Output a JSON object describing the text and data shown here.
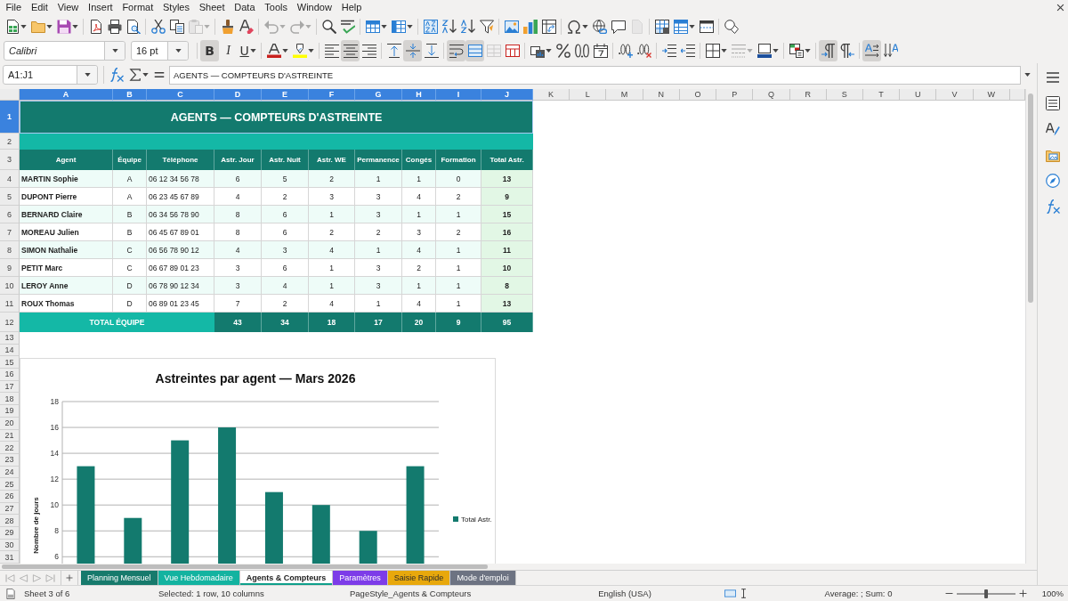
{
  "menu_bar": [
    "File",
    "Edit",
    "View",
    "Insert",
    "Format",
    "Styles",
    "Sheet",
    "Data",
    "Tools",
    "Window",
    "Help"
  ],
  "standard_toolbar": [
    [
      {
        "disabled": false
      },
      {
        "disabled": false
      },
      {
        "disabled": false
      }
    ],
    [
      {
        "disabled": false
      },
      {
        "disabled": false
      },
      {
        "disabled": false
      }
    ],
    [
      {
        "disabled": false
      },
      {
        "disabled": false
      },
      {
        "disabled": true
      }
    ],
    [
      {
        "disabled": false
      },
      {
        "disabled": false
      }
    ],
    [
      {
        "disabled": true
      },
      {
        "disabled": true
      }
    ],
    [
      {
        "disabled": false
      },
      {
        "disabled": false
      }
    ],
    [
      {
        "disabled": false
      },
      {
        "disabled": false
      }
    ],
    [
      {
        "disabled": false
      },
      {
        "disabled": false
      },
      {
        "disabled": false
      },
      {
        "disabled": false
      }
    ],
    [
      {
        "disabled": false
      },
      {
        "disabled": false
      },
      {
        "disabled": false
      }
    ],
    [
      {
        "disabled": false
      },
      {
        "disabled": false
      },
      {
        "disabled": false
      },
      {
        "disabled": true
      }
    ],
    [
      {
        "disabled": false
      },
      {
        "disabled": false
      },
      {
        "disabled": false
      }
    ],
    [
      {
        "disabled": false
      }
    ]
  ],
  "formatting_toolbar": {
    "font_name": "Calibri",
    "font_size": "16 pt",
    "text_style_buttons": [
      {
        "label": "B",
        "pressed": true
      },
      {
        "label": "I",
        "pressed": false
      },
      {
        "label": "U",
        "pressed": false
      }
    ],
    "groups": [
      [
        {
          "pressed": false,
          "disabled": false
        },
        {
          "pressed": false,
          "disabled": false
        }
      ],
      [
        {
          "pressed": false,
          "disabled": false
        },
        {
          "pressed": true,
          "disabled": false
        },
        {
          "pressed": false,
          "disabled": false
        }
      ],
      [
        {
          "pressed": false,
          "disabled": false
        },
        {
          "pressed": true,
          "disabled": false
        },
        {
          "pressed": false,
          "disabled": false
        }
      ],
      [
        {
          "pressed": true,
          "disabled": false
        },
        {
          "pressed": true,
          "disabled": false
        },
        {
          "pressed": false,
          "disabled": true
        },
        {
          "pressed": false,
          "disabled": false
        }
      ],
      [
        {
          "pressed": false,
          "disabled": false
        },
        {
          "pressed": false,
          "disabled": false
        },
        {
          "pressed": false,
          "disabled": false
        },
        {
          "pressed": false,
          "disabled": false
        }
      ],
      [
        {
          "pressed": false,
          "disabled": false
        },
        {
          "pressed": false,
          "disabled": false
        }
      ],
      [
        {
          "pressed": false,
          "disabled": false
        },
        {
          "pressed": false,
          "disabled": false
        }
      ],
      [
        {
          "pressed": false,
          "disabled": false
        },
        {
          "pressed": false,
          "disabled": true
        },
        {
          "pressed": false,
          "disabled": false
        }
      ],
      [
        {
          "pressed": false,
          "disabled": false
        }
      ],
      [
        {
          "pressed": true,
          "disabled": false
        },
        {
          "pressed": false,
          "disabled": false
        }
      ],
      [
        {
          "pressed": true,
          "disabled": false
        },
        {
          "pressed": false,
          "disabled": false
        }
      ]
    ]
  },
  "formula_bar": {
    "name_box": "A1:J1",
    "content": "AGENTS — COMPTEURS D'ASTREINTE"
  },
  "column_headers": [
    {
      "label": "A",
      "selected": true
    },
    {
      "label": "B",
      "selected": true
    },
    {
      "label": "C",
      "selected": true
    },
    {
      "label": "D",
      "selected": true
    },
    {
      "label": "E",
      "selected": true
    },
    {
      "label": "F",
      "selected": true
    },
    {
      "label": "G",
      "selected": true
    },
    {
      "label": "H",
      "selected": true
    },
    {
      "label": "I",
      "selected": true
    },
    {
      "label": "J",
      "selected": true
    },
    {
      "label": "K",
      "selected": false
    },
    {
      "label": "L",
      "selected": false
    },
    {
      "label": "M",
      "selected": false
    },
    {
      "label": "N",
      "selected": false
    },
    {
      "label": "O",
      "selected": false
    },
    {
      "label": "P",
      "selected": false
    },
    {
      "label": "Q",
      "selected": false
    },
    {
      "label": "R",
      "selected": false
    },
    {
      "label": "S",
      "selected": false
    },
    {
      "label": "T",
      "selected": false
    },
    {
      "label": "U",
      "selected": false
    },
    {
      "label": "V",
      "selected": false
    },
    {
      "label": "W",
      "selected": false
    }
  ],
  "row_headers": [
    {
      "label": "1",
      "selected": true
    },
    {
      "label": "2",
      "selected": false
    },
    {
      "label": "3",
      "selected": false
    },
    {
      "label": "4",
      "selected": false
    },
    {
      "label": "5",
      "selected": false
    },
    {
      "label": "6",
      "selected": false
    },
    {
      "label": "7",
      "selected": false
    },
    {
      "label": "8",
      "selected": false
    },
    {
      "label": "9",
      "selected": false
    },
    {
      "label": "10",
      "selected": false
    },
    {
      "label": "11",
      "selected": false
    },
    {
      "label": "12",
      "selected": false
    },
    {
      "label": "13",
      "selected": false
    },
    {
      "label": "14",
      "selected": false
    },
    {
      "label": "15",
      "selected": false
    },
    {
      "label": "16",
      "selected": false
    },
    {
      "label": "17",
      "selected": false
    },
    {
      "label": "18",
      "selected": false
    },
    {
      "label": "19",
      "selected": false
    },
    {
      "label": "20",
      "selected": false
    },
    {
      "label": "21",
      "selected": false
    },
    {
      "label": "22",
      "selected": false
    },
    {
      "label": "23",
      "selected": false
    },
    {
      "label": "24",
      "selected": false
    },
    {
      "label": "25",
      "selected": false
    },
    {
      "label": "26",
      "selected": false
    },
    {
      "label": "27",
      "selected": false
    },
    {
      "label": "28",
      "selected": false
    },
    {
      "label": "29",
      "selected": false
    },
    {
      "label": "30",
      "selected": false
    },
    {
      "label": "31",
      "selected": false
    }
  ],
  "table": {
    "title": "AGENTS — COMPTEURS D'ASTREINTE",
    "columns": [
      "Agent",
      "Équipe",
      "Téléphone",
      "Astr. Jour",
      "Astr. Nuit",
      "Astr. WE",
      "Permanence",
      "Congés",
      "Formation",
      "Total Astr."
    ],
    "rows": [
      [
        "MARTIN Sophie",
        "A",
        "06 12 34 56 78",
        "6",
        "5",
        "2",
        "1",
        "1",
        "0",
        "13"
      ],
      [
        "DUPONT Pierre",
        "A",
        "06 23 45 67 89",
        "4",
        "2",
        "3",
        "3",
        "4",
        "2",
        "9"
      ],
      [
        "BERNARD Claire",
        "B",
        "06 34 56 78 90",
        "8",
        "6",
        "1",
        "3",
        "1",
        "1",
        "15"
      ],
      [
        "MOREAU Julien",
        "B",
        "06 45 67 89 01",
        "8",
        "6",
        "2",
        "2",
        "3",
        "2",
        "16"
      ],
      [
        "SIMON Nathalie",
        "C",
        "06 56 78 90 12",
        "4",
        "3",
        "4",
        "1",
        "4",
        "1",
        "11"
      ],
      [
        "PETIT Marc",
        "C",
        "06 67 89 01 23",
        "3",
        "6",
        "1",
        "3",
        "2",
        "1",
        "10"
      ],
      [
        "LEROY Anne",
        "D",
        "06 78 90 12 34",
        "3",
        "4",
        "1",
        "3",
        "1",
        "1",
        "8"
      ],
      [
        "ROUX Thomas",
        "D",
        "06 89 01 23 45",
        "7",
        "2",
        "4",
        "1",
        "4",
        "1",
        "13"
      ]
    ],
    "total": {
      "label": "TOTAL ÉQUIPE",
      "values": [
        "43",
        "34",
        "18",
        "17",
        "20",
        "9",
        "95"
      ]
    }
  },
  "chart": {
    "chart_data": {
      "type": "bar",
      "title": "Astreintes par agent — Mars 2026",
      "ylabel": "Nombre de jours",
      "series": [
        {
          "name": "Total Astr.",
          "color": "#137a6e",
          "values": [
            13,
            9,
            15,
            16,
            11,
            10,
            8,
            13
          ]
        }
      ],
      "ylim": [
        5.4,
        18
      ],
      "yticks": [
        6,
        8,
        10,
        12,
        14,
        16,
        18
      ],
      "grid": true
    }
  },
  "sheet_tabs": [
    {
      "label": "Planning Mensuel",
      "color": "#177a6c",
      "selected": false
    },
    {
      "label": "Vue Hebdomadaire",
      "color": "#13b3a0",
      "selected": false
    },
    {
      "label": "Agents & Compteurs",
      "color": "#0e9f8a",
      "selected": true
    },
    {
      "label": "Paramètres",
      "color": "#7d3ce8",
      "selected": false
    },
    {
      "label": "Saisie Rapide",
      "color": "#e8a80c",
      "selected": false
    },
    {
      "label": "Mode d'emploi",
      "color": "#6d7382",
      "selected": false
    }
  ],
  "status_bar": {
    "sheet": "Sheet 3 of 6",
    "selection": "Selected: 1 row, 10 columns",
    "page_style": "PageStyle_Agents & Compteurs",
    "language": "English (USA)",
    "summary": "Average: ; Sum: 0",
    "zoom": {
      "level": 0.5,
      "reading": "100%"
    }
  }
}
